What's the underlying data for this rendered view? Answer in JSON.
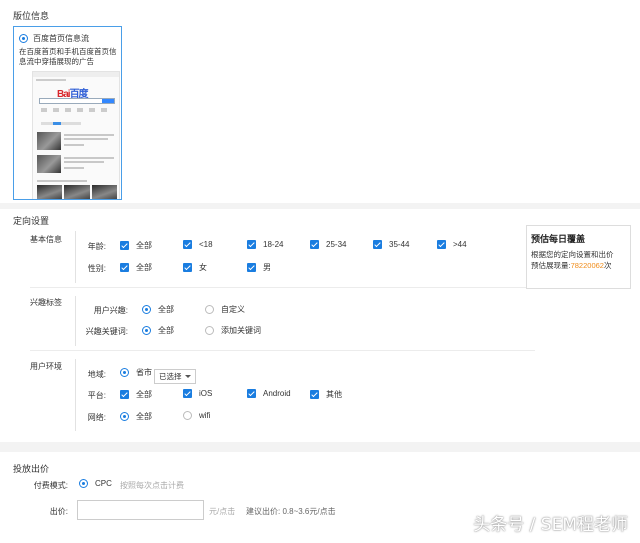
{
  "placement": {
    "title": "版位信息",
    "card": {
      "option_label": "百度首页信息流",
      "description": "在百度首页和手机百度首页信息流中穿插展现的广告",
      "preview_logo_a": "Bai",
      "preview_logo_b": "百度"
    }
  },
  "targeting": {
    "title": "定向设置",
    "basic": {
      "label": "基本信息",
      "age_label": "年龄:",
      "age_options": [
        "全部",
        "<18",
        "18-24",
        "25-34",
        "35-44",
        ">44"
      ],
      "gender_label": "性别:",
      "gender_options": [
        "全部",
        "女",
        "男"
      ]
    },
    "interest": {
      "label": "兴趣标签",
      "user_interest_label": "用户兴趣:",
      "user_interest_options": [
        "全部",
        "自定义"
      ],
      "keyword_label": "兴趣关键词:",
      "keyword_options": [
        "全部",
        "添加关键词"
      ]
    },
    "environment": {
      "label": "用户环境",
      "region_label": "地域:",
      "region_option": "省市",
      "region_dropdown": "已选择",
      "platform_label": "平台:",
      "platform_options": [
        "全部",
        "iOS",
        "Android",
        "其他"
      ],
      "network_label": "网络:",
      "network_options": [
        "全部",
        "wifi"
      ]
    },
    "estimate": {
      "title": "预估每日覆盖",
      "desc": "根据您的定向设置和出价",
      "reach_label": "预估展现量:",
      "reach_value": "78220062",
      "reach_unit": "次"
    }
  },
  "bid": {
    "title": "投放出价",
    "billing_label": "付费模式:",
    "billing_option": "CPC",
    "billing_hint": "按照每次点击计费",
    "price_label": "出价:",
    "price_unit": "元/点击",
    "suggest": "建议出价: 0.8~3.6元/点击"
  },
  "watermark": "头条号 / SEM程老师",
  "colors": {
    "accent": "#1a7de0",
    "highlight": "#f08c1a"
  }
}
